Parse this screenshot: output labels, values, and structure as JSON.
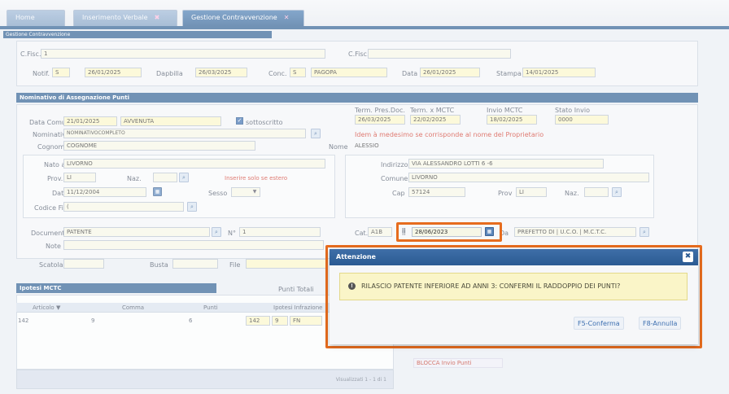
{
  "tabs": [
    {
      "label": "Home",
      "closable": false
    },
    {
      "label": "Inserimento Verbale",
      "closable": true
    },
    {
      "label": "Gestione Contravvenzione",
      "closable": true
    }
  ],
  "section_strip": "Gestione Contravvenzione",
  "header": {
    "cron_label": "C.Fisc.",
    "cron_value": "1",
    "cfisc_label": "C.Fisc.",
    "cfisc_value": "",
    "notif_label": "Notif.",
    "notif_value": "S",
    "notif_date": "26/01/2025",
    "dapbilla_label": "Dapbilla",
    "dapbilla_value": "26/03/2025",
    "conc_label": "Conc.",
    "conc_value": "S",
    "conc_desc": "PAGOPA",
    "data_label": "Data",
    "data_value": "26/01/2025",
    "stampa_label": "Stampa",
    "stampa_value": "14/01/2025"
  },
  "section_title": "Nominativo di Assegnazione Punti",
  "form": {
    "data_comun_label": "Data Comun.",
    "data_comun_value": "21/01/2025",
    "avvenuta_value": "AVVENUTA",
    "sottoscritto_label": "sottoscritto",
    "term_pres_doc_label": "Term. Pres.Doc.",
    "term_pres_doc_value": "26/03/2025",
    "term_mctc_label": "Term. x MCTC",
    "term_mctc_value": "22/02/2025",
    "invio_mctc_label": "Invio MCTC",
    "invio_mctc_value": "18/02/2025",
    "stato_invio_label": "Stato Invio",
    "stato_invio_value": "0000",
    "nominativo_label": "Nominativo",
    "nominativo_value": "NOMINATIVOCOMPLETO",
    "identity_note": "Idem à medesimo se corrisponde al nome del Proprietario",
    "cognome_label": "Cognome",
    "cognome_value": "COGNOME",
    "nome_label": "Nome",
    "nome_value": "ALESSIO",
    "nato_a_label": "Nato a",
    "nato_a_value": "LIVORNO",
    "prov_label": "Prov.",
    "prov_value": "LI",
    "naz_label": "Naz.",
    "naz_value": "",
    "estero_hint": "Inserire solo se estero",
    "data_label": "Data",
    "data_value": "11/12/2004",
    "sesso_label": "Sesso",
    "sesso_value": "",
    "codice_fis_label": "Codice Fis.",
    "codice_fis_value": "(",
    "indirizzo_label": "Indirizzo",
    "indirizzo_value": "VIA ALESSANDRO LOTTI 6 -6",
    "comune_label": "Comune",
    "comune_value": "LIVORNO",
    "cap_label": "Cap",
    "cap_value": "57124",
    "prov2_label": "Prov",
    "prov2_value": "LI",
    "naz2_label": "Naz.",
    "naz2_value": "",
    "documento_label": "Documento",
    "documento_value": "PATENTE",
    "numero_label": "N°",
    "numero_value": "1",
    "cat_label": "Cat.",
    "cat_value": "A1B",
    "il_label": "Il",
    "il_value": "28/06/2023",
    "da_label": "Da",
    "da_value": "PREFETTO DI | U.C.O. | M.C.T.C.",
    "note_label": "Note",
    "note_value": "",
    "scatola_label": "Scatola",
    "scatola_value": "",
    "busta_label": "Busta",
    "busta_value": "",
    "file_label": "File",
    "file_value": ""
  },
  "mctc": {
    "title": "Ipotesi MCTC",
    "punti_totali_label": "Punti Totali",
    "columns": [
      "Articolo ▼",
      "Comma",
      "Punti",
      "Ipotesi Infrazione"
    ],
    "rows": [
      {
        "articolo": "142",
        "comma": "9",
        "punti": "6",
        "ipotesi": "142",
        "ipotesi_comma": "9",
        "ipotesi_extra": "FN"
      }
    ],
    "footer": "Visualizzati 1 - 1 di 1",
    "blocca_label": "BLOCCA Invio Punti"
  },
  "dialog": {
    "title": "Attenzione",
    "message": "RILASCIO PATENTE INFERIORE AD ANNI 3: CONFERMI IL RADDOPPIO DEI PUNTI?",
    "confirm_label": "F5-Conferma",
    "cancel_label": "F8-Annulla"
  },
  "colors": {
    "accent": "#2f5f93",
    "highlight": "#e66c1e",
    "warning_bg": "#faf5c8",
    "alert_text": "#d03b2e"
  }
}
